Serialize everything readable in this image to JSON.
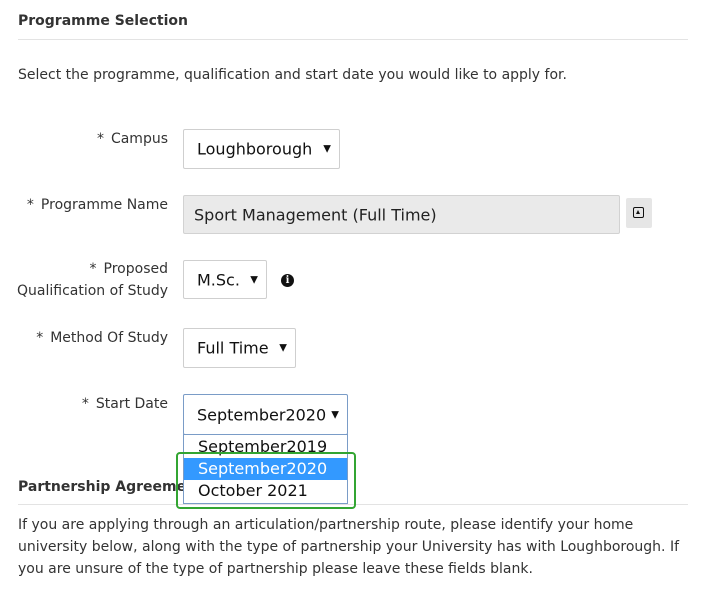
{
  "section": {
    "title": "Programme Selection",
    "intro": "Select the programme, qualification and start date you would like to apply for."
  },
  "fields": {
    "campus": {
      "label": "Campus",
      "value": "Loughborough"
    },
    "programme_name": {
      "label": "Programme Name",
      "value": "Sport Management (Full Time)"
    },
    "qualification": {
      "label_line1": "Proposed",
      "label_line2": "Qualification of Study",
      "value": "M.Sc."
    },
    "method": {
      "label": "Method Of Study",
      "value": "Full Time"
    },
    "start_date": {
      "label": "Start Date",
      "value": "September2020",
      "options": [
        "September2019",
        "September2020",
        "October 2021"
      ],
      "selected_index": 1
    }
  },
  "required_mark": "*",
  "partnership": {
    "title": "Partnership Agreement",
    "text": "If you are applying through an articulation/partnership route, please identify your home university below, along with the type of partnership your University has with Loughborough. If you are unsure of the type of partnership please leave these fields blank."
  },
  "icons": {
    "lookup": "lookup-icon",
    "info": "info-icon",
    "dropdown_arrow": "triangle-down-icon"
  },
  "colors": {
    "highlight_border": "#33a532",
    "option_selected_bg": "#3399ff"
  }
}
